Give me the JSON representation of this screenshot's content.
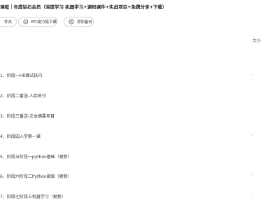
{
  "header": {
    "title": "课程｜年度钻石会员（深度学习 机器学习+源码课件+实战项目+免费分享+下载）"
  },
  "toolbar": {
    "folder_label": "件夹",
    "bt_download_label": "BT/磁力链下载",
    "add_backup_label": "添加备份"
  },
  "file_list": {
    "size_header": "大小",
    "rows": [
      {
        "name": "1、阶段一HR面试技巧",
        "size": "-"
      },
      {
        "name": "2、阶段二番送-人脸支付",
        "size": "-"
      },
      {
        "name": "3、阶段三番送-文本摘要项目",
        "size": "-"
      },
      {
        "name": "4、阶段四入学第一课",
        "size": "-"
      },
      {
        "name": "5、阶段五阶段一python基础（更新）",
        "size": "-"
      },
      {
        "name": "6、阶段六阶段二Python高级（更新）",
        "size": "-"
      },
      {
        "name": "7、阶段七阶段三机器学习（更新）",
        "size": "-"
      }
    ]
  }
}
